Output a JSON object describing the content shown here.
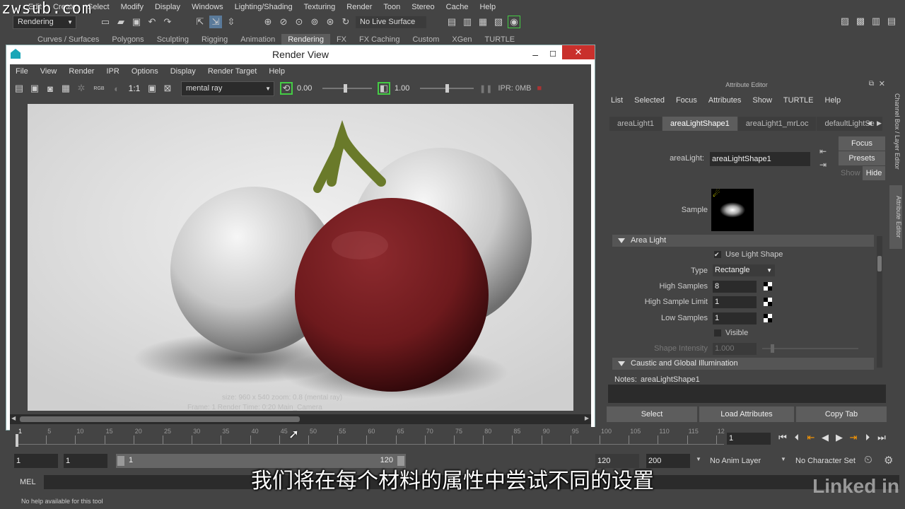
{
  "watermark": "zwsub.com",
  "menubar": [
    "Edit",
    "Create",
    "Select",
    "Modify",
    "Display",
    "Windows",
    "Lighting/Shading",
    "Texturing",
    "Render",
    "Toon",
    "Stereo",
    "Cache",
    "Help"
  ],
  "statusline": {
    "menuset": "Rendering",
    "live_surface": "No Live Surface"
  },
  "shelf_tabs": [
    "Curves / Surfaces",
    "Polygons",
    "Sculpting",
    "Rigging",
    "Animation",
    "Rendering",
    "FX",
    "FX Caching",
    "Custom",
    "XGen",
    "TURTLE"
  ],
  "shelf_active": "Rendering",
  "render_view": {
    "title": "Render View",
    "menu": [
      "File",
      "View",
      "Render",
      "IPR",
      "Options",
      "Display",
      "Render Target",
      "Help"
    ],
    "renderer": "mental ray",
    "one_to_one": "1:1",
    "rgb_label": "RGB",
    "exposure": "0.00",
    "gamma": "1.00",
    "ipr_mem": "IPR: 0MB",
    "overlay_line1": "size: 960 x 540   zoom: 0.8   (mental ray)",
    "overlay_line2": "Frame: 1     Render Time: 0:20     Main_Camera"
  },
  "attribute_editor": {
    "title": "Attribute Editor",
    "menu": [
      "List",
      "Selected",
      "Focus",
      "Attributes",
      "Show",
      "TURTLE",
      "Help"
    ],
    "tabs": [
      "areaLight1",
      "areaLightShape1",
      "areaLight1_mrLoc",
      "defaultLightSe"
    ],
    "active_tab": "areaLightShape1",
    "node_label": "areaLight:",
    "node_value": "areaLightShape1",
    "focus_btn": "Focus",
    "presets_btn": "Presets",
    "show_label": "Show",
    "hide_label": "Hide",
    "sample_label": "Sample",
    "section_area_light": "Area Light",
    "use_light_shape": "Use Light Shape",
    "type_label": "Type",
    "type_value": "Rectangle",
    "high_samples_label": "High Samples",
    "high_samples_value": "8",
    "high_sample_limit_label": "High Sample Limit",
    "high_sample_limit_value": "1",
    "low_samples_label": "Low Samples",
    "low_samples_value": "1",
    "visible_label": "Visible",
    "shape_intensity_label": "Shape Intensity",
    "shape_intensity_value": "1.000",
    "section_caustic": "Caustic and Global Illumination",
    "notes_label": "Notes:",
    "notes_value": "areaLightShape1",
    "select_btn": "Select",
    "load_attrs_btn": "Load Attributes",
    "copy_tab_btn": "Copy Tab",
    "side_tab_channel": "Channel Box / Layer Editor",
    "side_tab_attr": "Attribute Editor"
  },
  "timeline": {
    "tick_labels": [
      "1",
      "5",
      "10",
      "15",
      "20",
      "25",
      "30",
      "35",
      "40",
      "45",
      "50",
      "55",
      "60",
      "65",
      "70",
      "75",
      "80",
      "85",
      "90",
      "95",
      "100",
      "105",
      "110",
      "115",
      "12"
    ],
    "current_frame": "1"
  },
  "range": {
    "start": "1",
    "playback_start": "1",
    "slider_start": "1",
    "slider_end": "120",
    "playback_end": "120",
    "end": "200",
    "anim_layer": "No Anim Layer",
    "char_set": "No Character Set"
  },
  "mel_label": "MEL",
  "help_text": "No help available for this tool",
  "subtitle": "我们将在每个材料的属性中尝试不同的设置",
  "linkedin": "Linked in"
}
